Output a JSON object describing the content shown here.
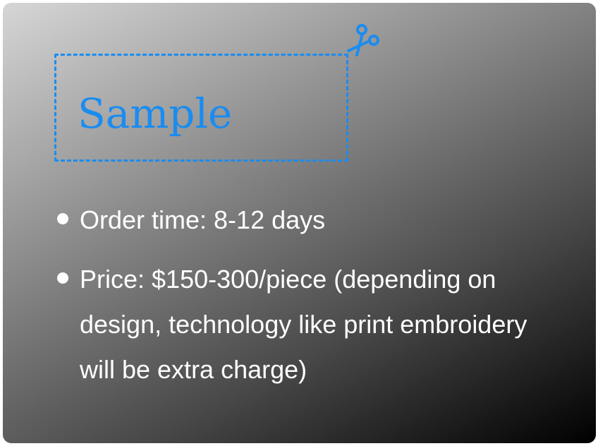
{
  "card": {
    "title": "Sample",
    "accent_color": "#1a8cf0",
    "icon": "scissors-icon",
    "bullets": [
      "Order time: 8-12 days",
      "Price: $150-300/piece (depending on design, technology like print embroidery will be extra charge)"
    ]
  }
}
